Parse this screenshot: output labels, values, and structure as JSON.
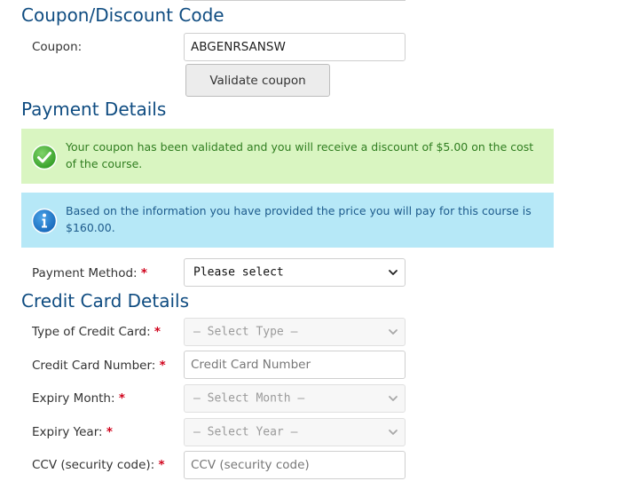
{
  "coupon_section": {
    "title": "Coupon/Discount Code",
    "coupon_label": "Coupon:",
    "coupon_value": "ABGENRSANSW",
    "validate_button_label": "Validate coupon"
  },
  "payment_section": {
    "title": "Payment Details",
    "success_alert": {
      "icon": "check-circle-icon",
      "text": "Your coupon has been validated and you will receive a discount of $5.00 on the cost of the course."
    },
    "info_alert": {
      "icon": "info-circle-icon",
      "text": "Based on the information you have provided the price you will pay for this course is $160.00."
    },
    "payment_method_label": "Payment Method:",
    "payment_method_value": "Please select"
  },
  "credit_card_section": {
    "title": "Credit Card Details",
    "card_type_label": "Type of Credit Card:",
    "card_type_value": "– Select Type –",
    "card_number_label": "Credit Card Number:",
    "card_number_placeholder": "Credit Card Number",
    "expiry_month_label": "Expiry Month:",
    "expiry_month_value": "– Select Month –",
    "expiry_year_label": "Expiry Year:",
    "expiry_year_value": "– Select Year –",
    "ccv_label": "CCV (security code):",
    "ccv_placeholder": "CCV (security code)"
  },
  "required_marker": "*",
  "colors": {
    "heading": "#0f4c81",
    "required": "#d0021b",
    "success_bg": "#d9f5c1",
    "success_text": "#2f7d1f",
    "info_bg": "#b6e8f7",
    "info_text": "#1d5b8c"
  }
}
